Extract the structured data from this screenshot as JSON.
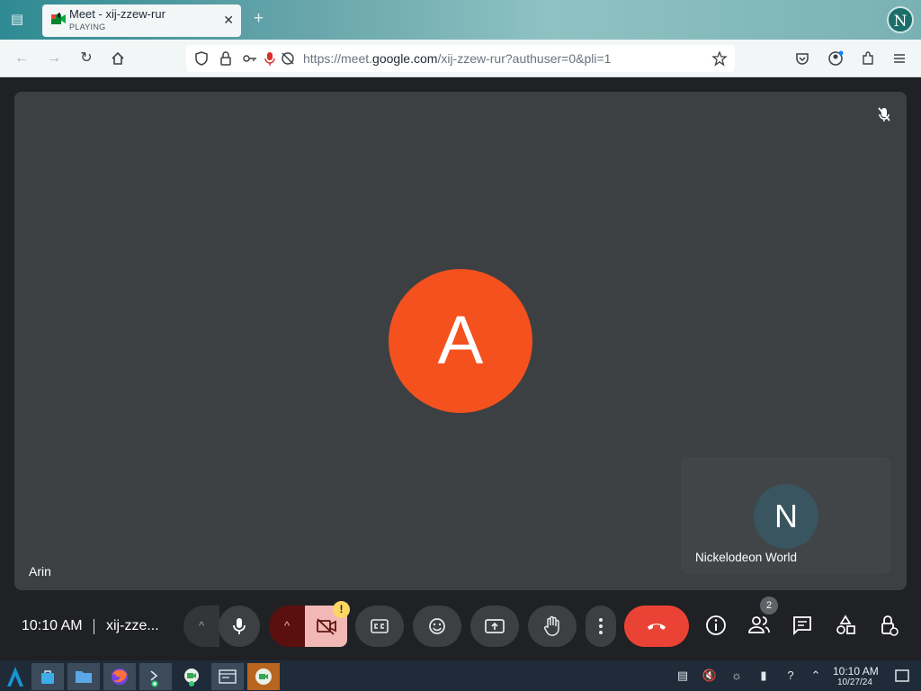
{
  "browser": {
    "tab_title": "Meet - xij-zzew-rur",
    "tab_subtitle": "PLAYING",
    "new_tab_glyph": "+",
    "close_glyph": "✕",
    "profile_initial": "N",
    "url_prefix": "https://meet.",
    "url_domain": "google.com",
    "url_suffix": "/xij-zzew-rur?authuser=0&pli=1"
  },
  "meeting": {
    "main_participant_initial": "A",
    "main_participant_name": "Arin",
    "self_initial": "N",
    "self_name": "Nickelodeon World",
    "clock": "10:10 AM",
    "code": "xij-zze...",
    "participants_count": "2",
    "camera_warning": "!",
    "accent_colors": {
      "main_avatar": "#f4511e",
      "self_avatar": "#385560",
      "end_call": "#ea4335",
      "camera_off": "#f2b8b5"
    }
  },
  "taskbar": {
    "time": "10:10 AM",
    "date": "10/27/24"
  }
}
